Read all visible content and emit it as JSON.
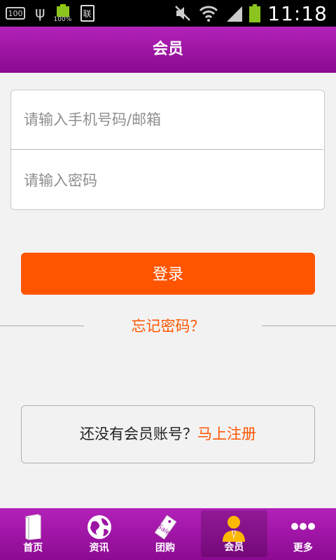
{
  "status_bar": {
    "battery_box_text": "100",
    "battery_percent": "100%",
    "sim_text": "联",
    "time": "11:18"
  },
  "header": {
    "title": "会员"
  },
  "login_form": {
    "phone_placeholder": "请输入手机号码/邮箱",
    "password_placeholder": "请输入密码",
    "login_button": "登录",
    "forgot_password": "忘记密码？"
  },
  "register": {
    "prompt": "还没有会员账号？",
    "link": "马上注册"
  },
  "tab_bar": {
    "items": [
      {
        "label": "首页",
        "icon": "book-icon"
      },
      {
        "label": "资讯",
        "icon": "globe-icon"
      },
      {
        "label": "团购",
        "icon": "sale-tag-icon"
      },
      {
        "label": "会员",
        "icon": "member-icon",
        "active": true
      },
      {
        "label": "更多",
        "icon": "more-dots-icon"
      }
    ]
  },
  "colors": {
    "accent": "#ff5500",
    "header_purple": "#9c15a3"
  }
}
